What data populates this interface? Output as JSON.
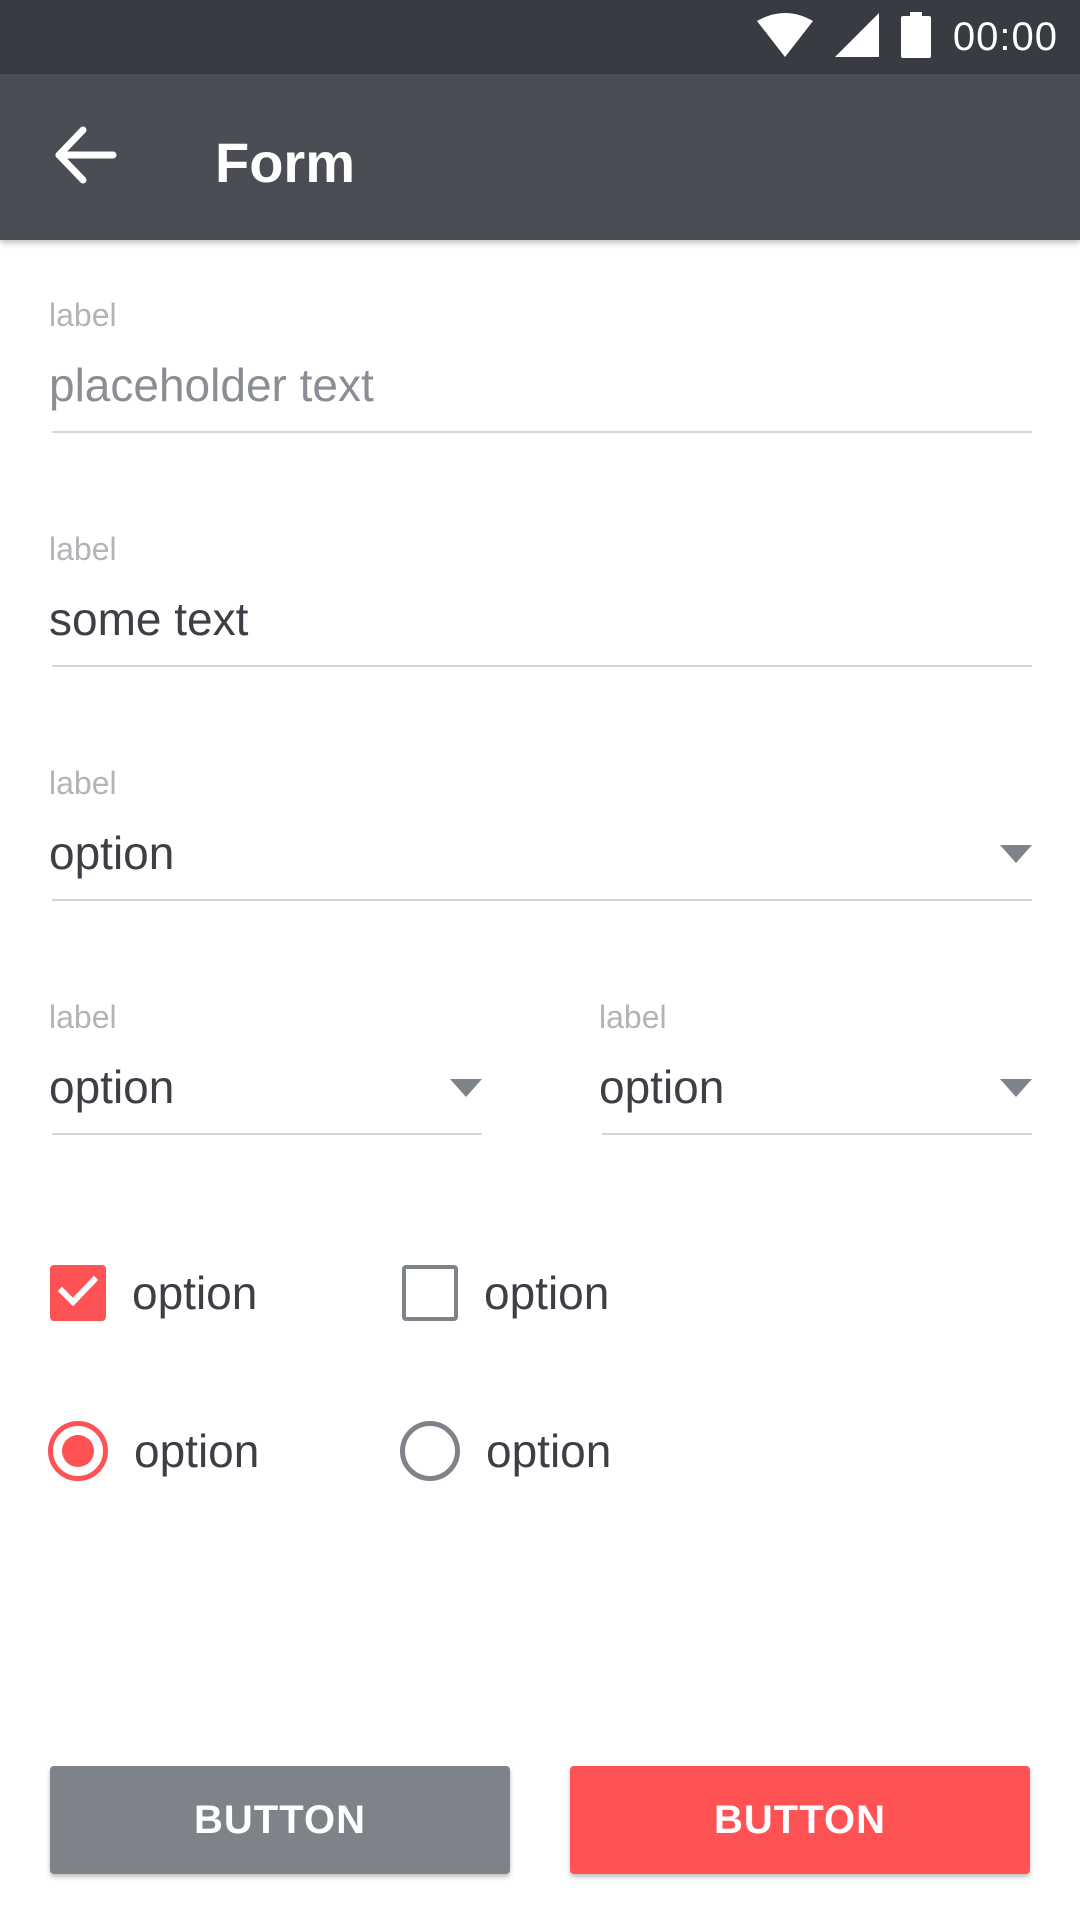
{
  "status_bar": {
    "time": "00:00",
    "icons": [
      "wifi-icon",
      "signal-icon",
      "battery-icon"
    ]
  },
  "app_bar": {
    "title": "Form",
    "back_icon": "arrow-left-icon"
  },
  "form": {
    "text_field_1": {
      "label": "label",
      "value": "",
      "placeholder": "placeholder text"
    },
    "text_field_2": {
      "label": "label",
      "value": "some text"
    },
    "select_full": {
      "label": "label",
      "value": "option"
    },
    "select_left": {
      "label": "label",
      "value": "option"
    },
    "select_right": {
      "label": "label",
      "value": "option"
    },
    "checkboxes": [
      {
        "label": "option",
        "checked": true
      },
      {
        "label": "option",
        "checked": false
      }
    ],
    "radios": [
      {
        "label": "option",
        "selected": true
      },
      {
        "label": "option",
        "selected": false
      }
    ]
  },
  "buttons": {
    "secondary_label": "BUTTON",
    "primary_label": "BUTTON"
  },
  "colors": {
    "status_bar": "#383b41",
    "app_bar": "#4a4d53",
    "accent": "#fe5255",
    "secondary_button": "#7e8389"
  }
}
